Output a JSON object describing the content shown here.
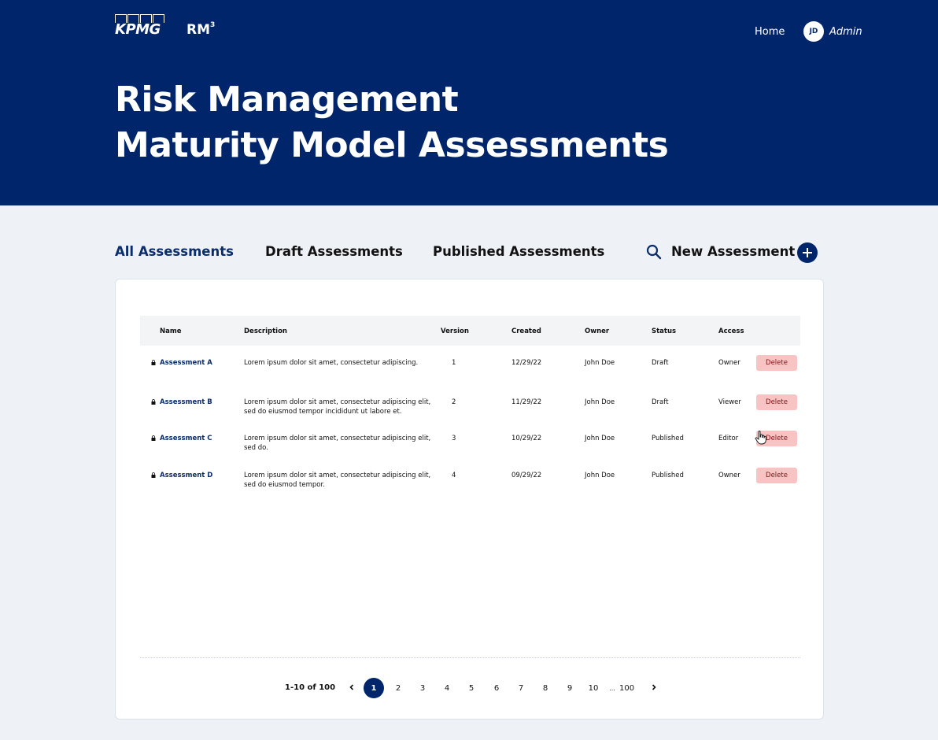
{
  "header": {
    "brand": "KPMG",
    "product": "RM",
    "product_sup": "3",
    "nav_home": "Home",
    "user_initials": "JD",
    "user_name": "Admin",
    "title_line1": "Risk Management",
    "title_line2": "Maturity Model Assessments"
  },
  "tabs": [
    {
      "label": "All Assessments",
      "active": true
    },
    {
      "label": "Draft Assessments",
      "active": false
    },
    {
      "label": "Published Assessments",
      "active": false
    }
  ],
  "actions": {
    "search_icon": "search-icon",
    "new_label": "New Assessment",
    "new_icon": "plus-icon"
  },
  "table": {
    "columns": [
      "Name",
      "Description",
      "Version",
      "Created",
      "Owner",
      "Status",
      "Access"
    ],
    "rows": [
      {
        "name": "Assessment A",
        "description": "Lorem ipsum dolor sit amet, consectetur adipiscing.",
        "version": "1",
        "created": "12/29/22",
        "owner": "John Doe",
        "status": "Draft",
        "access": "Owner",
        "action": "Delete"
      },
      {
        "name": "Assessment B",
        "description": "Lorem ipsum dolor sit amet, consectetur adipiscing elit, sed do eiusmod tempor incididunt ut labore et.",
        "version": "2",
        "created": "11/29/22",
        "owner": "John Doe",
        "status": "Draft",
        "access": "Viewer",
        "action": "Delete"
      },
      {
        "name": "Assessment C",
        "description": "Lorem ipsum dolor sit amet, consectetur adipiscing elit, sed do.",
        "version": "3",
        "created": "10/29/22",
        "owner": "John Doe",
        "status": "Published",
        "access": "Editor",
        "action": "Delete"
      },
      {
        "name": "Assessment D",
        "description": "Lorem ipsum dolor sit amet, consectetur adipiscing elit, sed do eiusmod tempor.",
        "version": "4",
        "created": "09/29/22",
        "owner": "John Doe",
        "status": "Published",
        "access": "Owner",
        "action": "Delete"
      }
    ]
  },
  "pagination": {
    "range": "1-10 of 100",
    "current": "1",
    "pages": [
      "1",
      "2",
      "3",
      "4",
      "5",
      "6",
      "7",
      "8",
      "9",
      "10"
    ],
    "ellipsis": "...",
    "last": "100"
  },
  "colors": {
    "brand_navy": "#00256a",
    "delete_bg": "#f7c3c3",
    "page_bg": "#eef1f6"
  }
}
